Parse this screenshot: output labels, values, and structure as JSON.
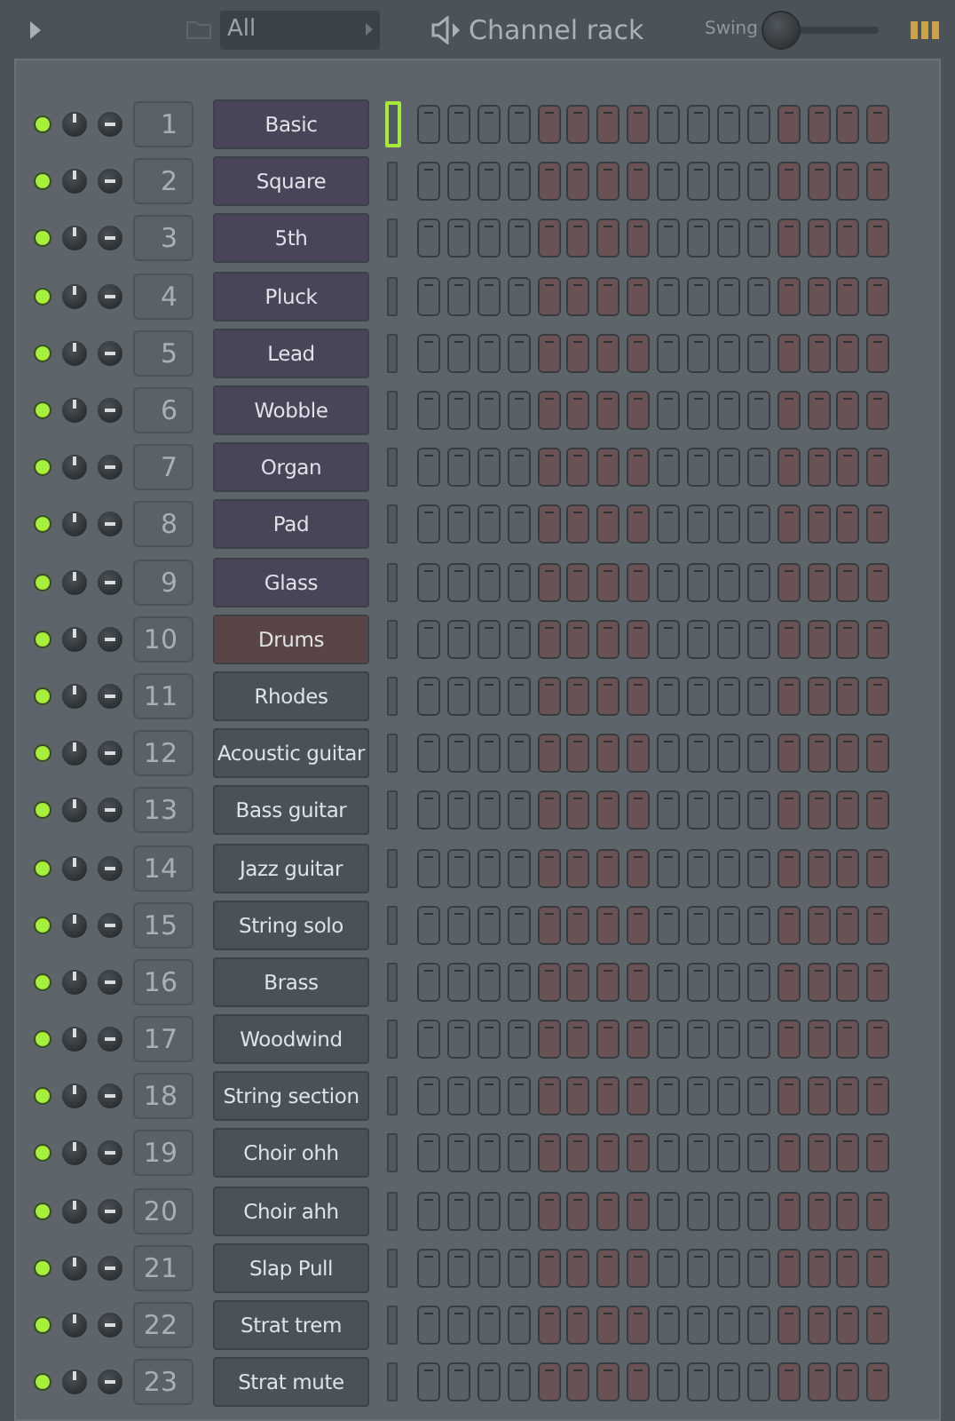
{
  "window": {
    "title": "Channel rack"
  },
  "filter": {
    "value": "All"
  },
  "swing": {
    "label": "Swing"
  },
  "channels": [
    {
      "number": "1",
      "name": "Basic",
      "color": "#4a4458",
      "selected": true
    },
    {
      "number": "2",
      "name": "Square",
      "color": "#4a4458",
      "selected": false
    },
    {
      "number": "3",
      "name": "5th",
      "color": "#4a4458",
      "selected": false
    },
    {
      "number": "4",
      "name": "Pluck",
      "color": "#4a4458",
      "selected": false
    },
    {
      "number": "5",
      "name": "Lead",
      "color": "#4a4458",
      "selected": false
    },
    {
      "number": "6",
      "name": "Wobble",
      "color": "#4a4458",
      "selected": false
    },
    {
      "number": "7",
      "name": "Organ",
      "color": "#4a4458",
      "selected": false
    },
    {
      "number": "8",
      "name": "Pad",
      "color": "#4a4458",
      "selected": false
    },
    {
      "number": "9",
      "name": "Glass",
      "color": "#4a4458",
      "selected": false
    },
    {
      "number": "10",
      "name": "Drums",
      "color": "#5a4546",
      "selected": false
    },
    {
      "number": "11",
      "name": "Rhodes",
      "color": "#4a5259",
      "selected": false
    },
    {
      "number": "12",
      "name": "Acoustic guitar",
      "color": "#4a5259",
      "selected": false
    },
    {
      "number": "13",
      "name": "Bass guitar",
      "color": "#4a5259",
      "selected": false
    },
    {
      "number": "14",
      "name": "Jazz guitar",
      "color": "#4a5259",
      "selected": false
    },
    {
      "number": "15",
      "name": "String solo",
      "color": "#4a5259",
      "selected": false
    },
    {
      "number": "16",
      "name": "Brass",
      "color": "#4a5259",
      "selected": false
    },
    {
      "number": "17",
      "name": "Woodwind",
      "color": "#4a5259",
      "selected": false
    },
    {
      "number": "18",
      "name": "String section",
      "color": "#4a5259",
      "selected": false
    },
    {
      "number": "19",
      "name": "Choir ohh",
      "color": "#4a5259",
      "selected": false
    },
    {
      "number": "20",
      "name": "Choir ahh",
      "color": "#4a5259",
      "selected": false
    },
    {
      "number": "21",
      "name": "Slap Pull",
      "color": "#4a5259",
      "selected": false
    },
    {
      "number": "22",
      "name": "Strat trem",
      "color": "#4a5259",
      "selected": false
    },
    {
      "number": "23",
      "name": "Strat mute",
      "color": "#4a5259",
      "selected": false
    }
  ]
}
